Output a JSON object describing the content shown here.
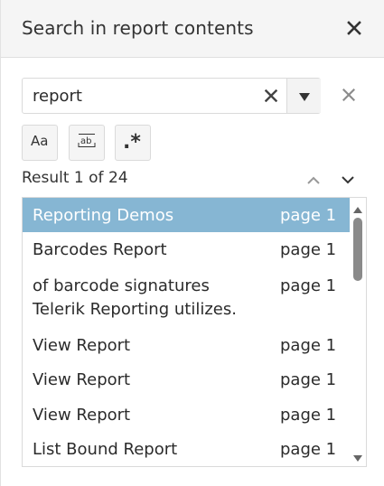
{
  "header": {
    "title": "Search in report contents",
    "close_icon": "close-icon"
  },
  "search": {
    "value": "report",
    "clear_icon": "clear-icon",
    "dropdown_icon": "caret-down-icon",
    "outer_clear_icon": "close-icon"
  },
  "options": {
    "match_case_label": "Aa",
    "whole_word_label": "ab",
    "regex_label": ".*"
  },
  "results": {
    "count_text": "Result 1 of 24",
    "prev_icon": "chevron-up-icon",
    "next_icon": "chevron-down-icon",
    "items": [
      {
        "text": "Reporting Demos",
        "page": "page 1",
        "selected": true
      },
      {
        "text": "Barcodes Report",
        "page": "page 1",
        "selected": false
      },
      {
        "text": "of barcode signatures\nTelerik Reporting utilizes.",
        "page": "page 1",
        "selected": false
      },
      {
        "text": "View Report",
        "page": "page 1",
        "selected": false
      },
      {
        "text": "View Report",
        "page": "page 1",
        "selected": false
      },
      {
        "text": "View Report",
        "page": "page 1",
        "selected": false
      },
      {
        "text": "List Bound Report",
        "page": "page 1",
        "selected": false
      }
    ]
  },
  "colors": {
    "selected_row": "#86b6d3",
    "header_bg": "#f5f5f5"
  }
}
